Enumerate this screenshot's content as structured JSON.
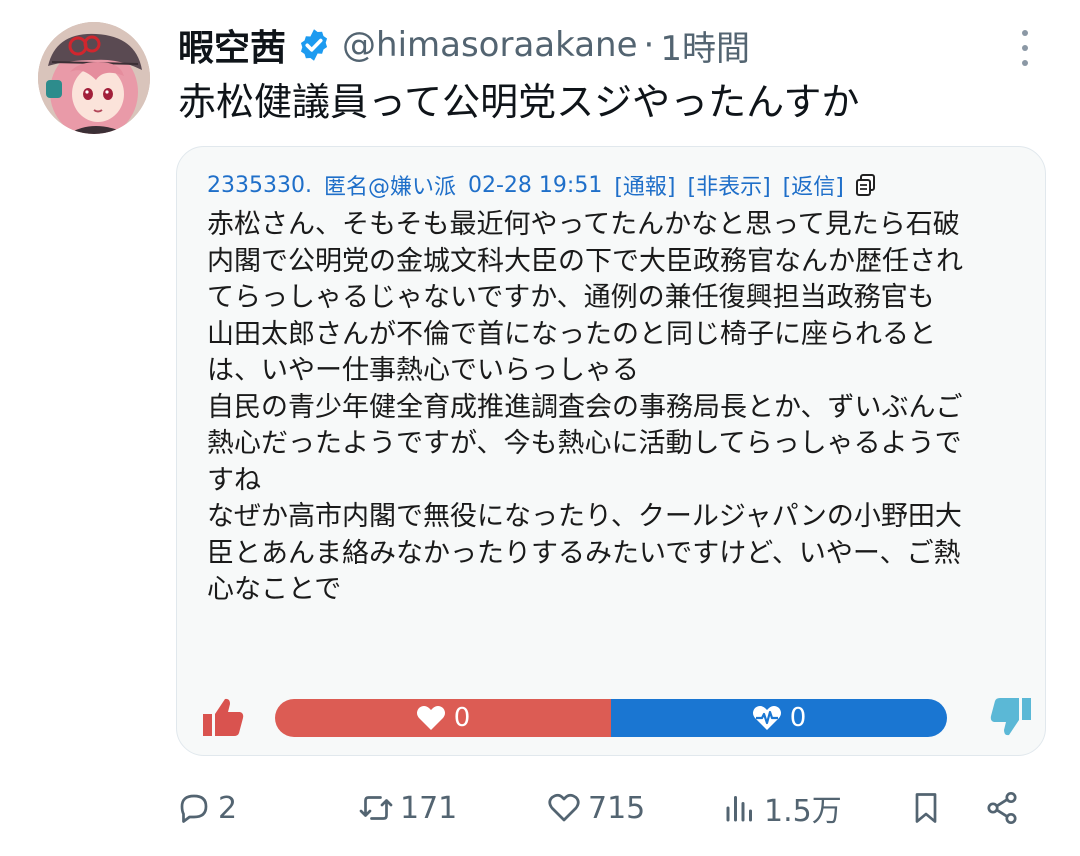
{
  "author": {
    "display_name": "暇空茜",
    "handle": "@himasoraakane",
    "separator": "·",
    "time": "1時間",
    "verified_icon": "verified-badge-icon"
  },
  "tweet": {
    "text": "赤松健議員って公明党スジやったんすか"
  },
  "quote_card": {
    "post_number": "2335330.",
    "poster_name": "匿名@嫌い派",
    "posted_at": "02-28 19:51",
    "links": {
      "report": "[通報]",
      "hide": "[非表示]",
      "reply": "[返信]"
    },
    "body_lines": [
      "赤松さん、そもそも最近何やってたんかなと思って見たら石破",
      "内閣で公明党の金城文科大臣の下で大臣政務官なんか歴任され",
      "てらっしゃるじゃないですか、通例の兼任復興担当政務官も",
      "山田太郎さんが不倫で首になったのと同じ椅子に座られると",
      "は、いやー仕事熱心でいらっしゃる",
      "自民の青少年健全育成推進調査会の事務局長とか、ずいぶんご",
      "熱心だったようですが、今も熱心に活動してらっしゃるようで",
      "すね",
      "なぜか高市内閣で無役になったり、クールジャパンの小野田大",
      "臣とあんま絡みなかったりするみたいですけど、いやー、ご熱",
      "心なことで"
    ],
    "votes": {
      "like_count": "0",
      "dislike_count": "0",
      "like_color": "#dc5c54",
      "dislike_color": "#1a76d2"
    }
  },
  "actions": {
    "replies": "2",
    "reposts": "171",
    "likes": "715",
    "views": "1.5万"
  },
  "colors": {
    "text_primary": "#0f1419",
    "text_secondary": "#536471",
    "link_blue": "#1f6fc9",
    "verified_blue": "#1d9bf0"
  }
}
